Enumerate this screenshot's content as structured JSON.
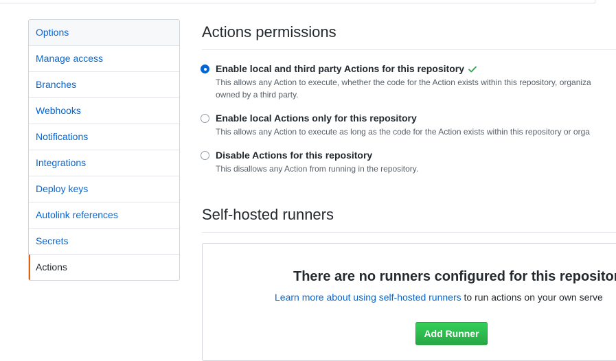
{
  "sidebar": {
    "items": [
      {
        "label": "Options"
      },
      {
        "label": "Manage access"
      },
      {
        "label": "Branches"
      },
      {
        "label": "Webhooks"
      },
      {
        "label": "Notifications"
      },
      {
        "label": "Integrations"
      },
      {
        "label": "Deploy keys"
      },
      {
        "label": "Autolink references"
      },
      {
        "label": "Secrets"
      },
      {
        "label": "Actions",
        "selected": true
      }
    ]
  },
  "permissions": {
    "title": "Actions permissions",
    "options": [
      {
        "label": "Enable local and third party Actions for this repository",
        "desc": "This allows any Action to execute, whether the code for the Action exists within this repository, organiza",
        "desc2": "owned by a third party.",
        "checked": true,
        "icon": "check-icon"
      },
      {
        "label": "Enable local Actions only for this repository",
        "desc": "This allows any Action to execute as long as the code for the Action exists within this repository or orga",
        "checked": false
      },
      {
        "label": "Disable Actions for this repository",
        "desc": "This disallows any Action from running in the repository.",
        "checked": false
      }
    ]
  },
  "runners": {
    "title": "Self-hosted runners",
    "empty_title": "There are no runners configured for this repository.",
    "learn_link": "Learn more about using self-hosted runners",
    "desc_suffix": " to run actions on your own serve",
    "add_button": "Add Runner"
  },
  "colors": {
    "link": "#0366d6",
    "selected_accent": "#e36209",
    "success": "#28a745"
  }
}
